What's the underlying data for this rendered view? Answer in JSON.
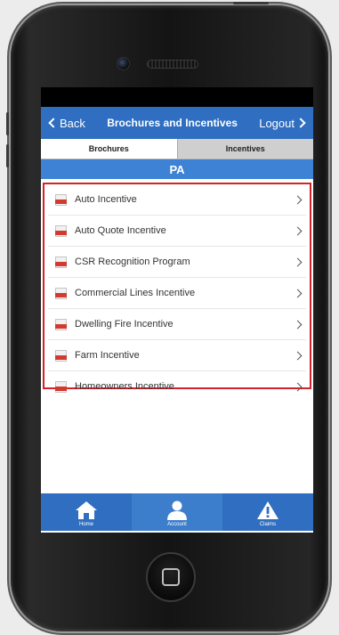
{
  "header": {
    "back_label": "Back",
    "title": "Brochures and Incentives",
    "logout_label": "Logout"
  },
  "tabs": [
    {
      "label": "Brochures",
      "selected": true
    },
    {
      "label": "Incentives",
      "selected": false
    }
  ],
  "region": "PA",
  "items": [
    {
      "label": "Auto Incentive",
      "icon": "pdf-icon"
    },
    {
      "label": "Auto Quote Incentive",
      "icon": "pdf-icon"
    },
    {
      "label": "CSR Recognition Program",
      "icon": "pdf-icon"
    },
    {
      "label": "Commercial Lines Incentive",
      "icon": "pdf-icon"
    },
    {
      "label": "Dwelling Fire Incentive",
      "icon": "pdf-icon"
    },
    {
      "label": "Farm Incentive",
      "icon": "pdf-icon"
    },
    {
      "label": "Homeowners Incentive",
      "icon": "pdf-icon"
    }
  ],
  "tabbar": [
    {
      "label": "Home",
      "icon": "home-icon"
    },
    {
      "label": "Account",
      "icon": "person-icon"
    },
    {
      "label": "Claims",
      "icon": "warning-icon"
    }
  ],
  "colors": {
    "header_blue": "#2f6ec0",
    "region_blue": "#3d82d4",
    "highlight_red": "#d2232a",
    "pdf_red": "#d23a30"
  }
}
